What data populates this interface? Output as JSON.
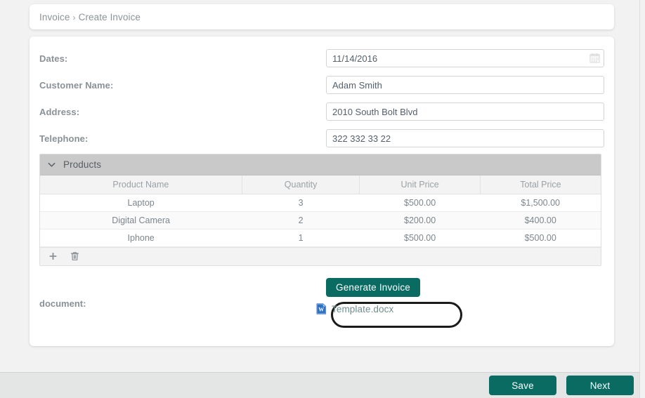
{
  "breadcrumb": {
    "root": "Invoice",
    "separator": "›",
    "current": "Create Invoice"
  },
  "form": {
    "fields": [
      {
        "label": "Dates:",
        "value": "11/14/2016",
        "placeholder": "",
        "icon": "calendar-icon"
      },
      {
        "label": "Customer Name:",
        "value": "Adam Smith",
        "placeholder": "",
        "icon": ""
      },
      {
        "label": "Address:",
        "value": "2010 South Bolt Blvd",
        "placeholder": "",
        "icon": ""
      },
      {
        "label": "Telephone:",
        "value": "322 332 33 22",
        "placeholder": "",
        "icon": ""
      }
    ]
  },
  "products_panel": {
    "title": "Products",
    "collapse_icon": "chevron-down-icon",
    "columns": [
      "Product Name",
      "Quantity",
      "Unit Price",
      "Total Price"
    ],
    "rows": [
      {
        "name": "Laptop",
        "quantity": "3",
        "unit_price": "$500.00",
        "total_price": "$1,500.00"
      },
      {
        "name": "Digital Camera",
        "quantity": "2",
        "unit_price": "$200.00",
        "total_price": "$400.00"
      },
      {
        "name": "Iphone",
        "quantity": "1",
        "unit_price": "$500.00",
        "total_price": "$500.00"
      }
    ],
    "toolbar": {
      "add_icon": "plus-icon",
      "delete_icon": "trash-icon"
    }
  },
  "actions": {
    "generate_invoice": "Generate Invoice"
  },
  "document": {
    "label": "document:",
    "file_icon": "word-document-icon",
    "file_name": "Template.docx"
  },
  "footer": {
    "save": "Save",
    "next": "Next"
  },
  "colors": {
    "accent": "#0a6b63",
    "page_background": "#f2f2f2",
    "panel_header": "#c9c9c9",
    "footer_background": "#e4e6e6",
    "link": "#6f8e8d",
    "label": "#8a9196",
    "annotation": "#1a1a1a"
  }
}
